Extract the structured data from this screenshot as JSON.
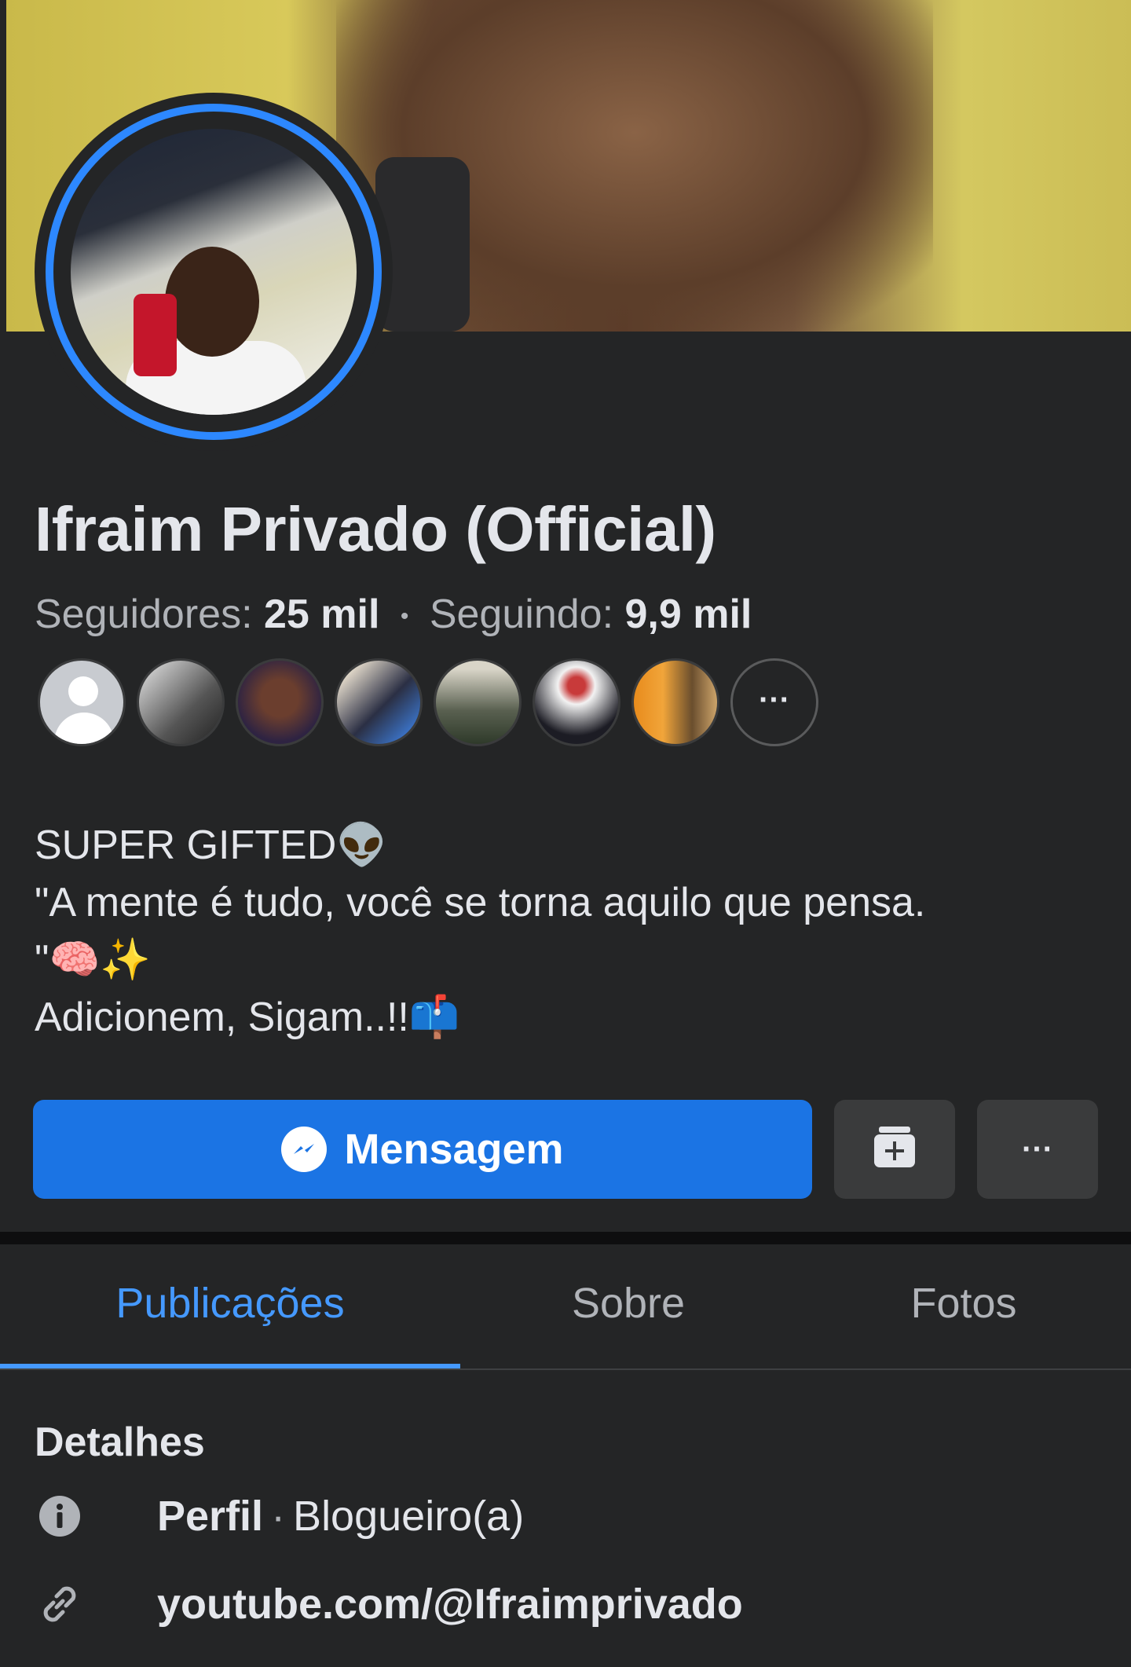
{
  "profile": {
    "name": "Ifraim Privado (Official)",
    "followers_label": "Seguidores:",
    "followers_count": "25 mil",
    "following_label": "Seguindo:",
    "following_count": "9,9 mil",
    "more_followers": "···"
  },
  "bio": {
    "line1": "SUPER GIFTED👽",
    "line2": "\"A mente é tudo, você se torna aquilo que pensa.",
    "line3": "\"🧠✨",
    "line4": "Adicionem, Sigam..!!📫"
  },
  "actions": {
    "message_label": "Mensagem",
    "more_label": "···"
  },
  "tabs": [
    {
      "label": "Publicações",
      "active": true
    },
    {
      "label": "Sobre",
      "active": false
    },
    {
      "label": "Fotos",
      "active": false
    }
  ],
  "details": {
    "title": "Detalhes",
    "profile_label": "Perfil",
    "profile_category": "Blogueiro(a)",
    "link": "youtube.com/@Ifraimprivado"
  },
  "icons": {
    "messenger": "messenger-icon",
    "save": "save-icon",
    "info": "info-icon",
    "link": "link-icon"
  },
  "colors": {
    "accent": "#1b74e4",
    "tab_active": "#4599ff",
    "background": "#242526"
  }
}
